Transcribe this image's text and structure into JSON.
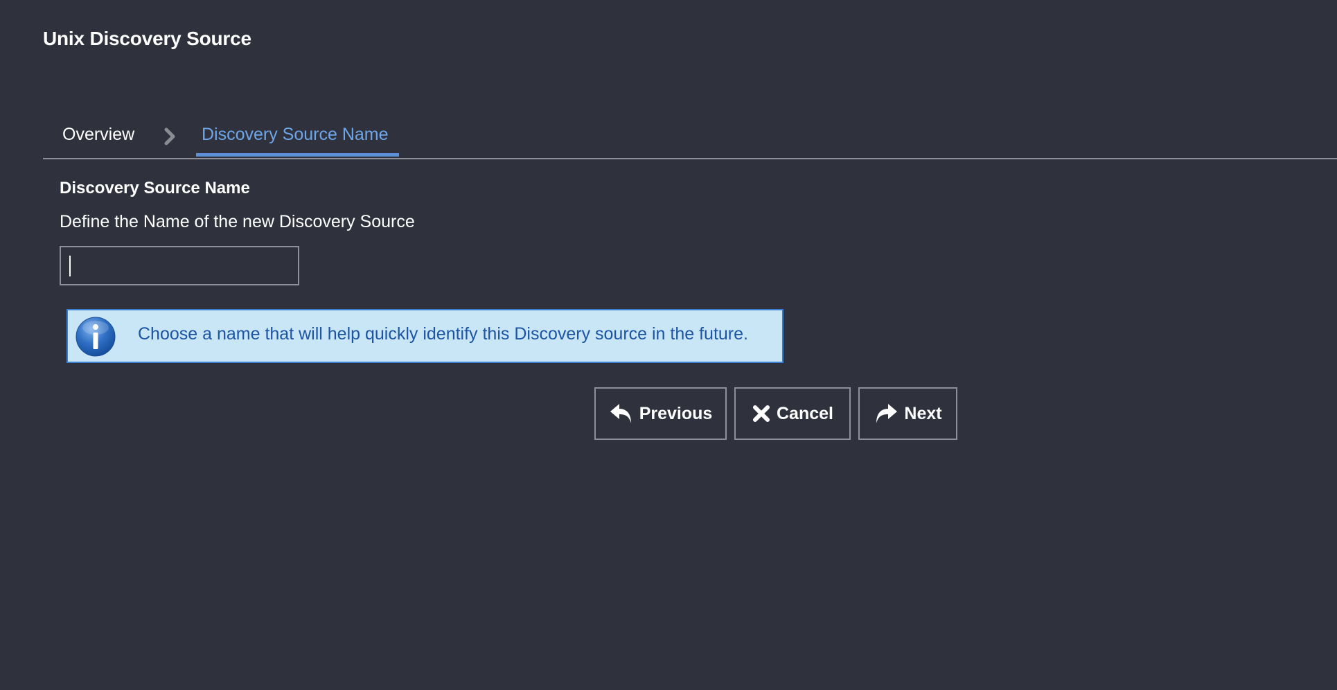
{
  "header": {
    "title": "Unix Discovery Source"
  },
  "wizard": {
    "steps": [
      {
        "label": "Overview",
        "active": false
      },
      {
        "label": "Discovery Source Name",
        "active": true
      }
    ],
    "separator_icon": "chevron-right-icon"
  },
  "section": {
    "title": "Discovery Source Name",
    "description": "Define the Name of the new Discovery Source"
  },
  "name_input": {
    "value": "",
    "placeholder": ""
  },
  "info": {
    "icon": "info-icon",
    "message": "Choose a name that will help quickly identify this Discovery source in the future."
  },
  "buttons": {
    "previous": {
      "label": "Previous",
      "icon": "reply-arrow-icon"
    },
    "cancel": {
      "label": "Cancel",
      "icon": "close-icon"
    },
    "next": {
      "label": "Next",
      "icon": "forward-arrow-icon"
    }
  },
  "colors": {
    "background": "#2f323c",
    "active_step": "#6ea6ea",
    "info_background": "#c9e6f7",
    "info_border": "#3c7fd0",
    "info_text": "#1d55a3"
  }
}
